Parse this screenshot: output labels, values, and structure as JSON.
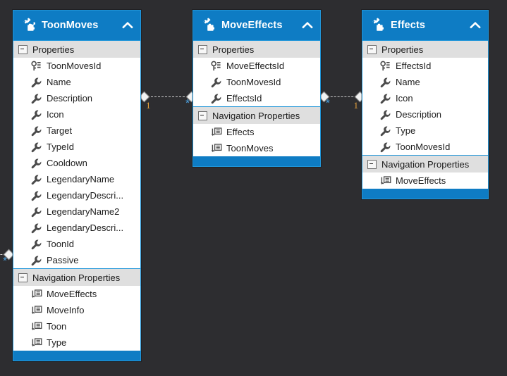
{
  "canvas": {
    "background": "#2d2d30",
    "accent": "#0e7cc4",
    "border": "#2196d9",
    "section_background": "#dfdfdf"
  },
  "entities": [
    {
      "name": "ToonMoves",
      "icon": "entity-icon",
      "collapse_icon": "chevron-up-icon",
      "sections": [
        {
          "label": "Properties",
          "expander_icon": "collapse-box-icon",
          "items": [
            {
              "label": "ToonMovesId",
              "icon": "key-icon"
            },
            {
              "label": "Name",
              "icon": "scalar-property-icon"
            },
            {
              "label": "Description",
              "icon": "scalar-property-icon"
            },
            {
              "label": "Icon",
              "icon": "scalar-property-icon"
            },
            {
              "label": "Target",
              "icon": "scalar-property-icon"
            },
            {
              "label": "TypeId",
              "icon": "scalar-property-icon"
            },
            {
              "label": "Cooldown",
              "icon": "scalar-property-icon"
            },
            {
              "label": "LegendaryName",
              "icon": "scalar-property-icon"
            },
            {
              "label": "LegendaryDescri...",
              "icon": "scalar-property-icon"
            },
            {
              "label": "LegendaryName2",
              "icon": "scalar-property-icon"
            },
            {
              "label": "LegendaryDescri...",
              "icon": "scalar-property-icon"
            },
            {
              "label": "ToonId",
              "icon": "scalar-property-icon"
            },
            {
              "label": "Passive",
              "icon": "scalar-property-icon"
            }
          ]
        },
        {
          "label": "Navigation Properties",
          "expander_icon": "collapse-box-icon",
          "items": [
            {
              "label": "MoveEffects",
              "icon": "navigation-property-icon"
            },
            {
              "label": "MoveInfo",
              "icon": "navigation-property-icon"
            },
            {
              "label": "Toon",
              "icon": "navigation-property-icon"
            },
            {
              "label": "Type",
              "icon": "navigation-property-icon"
            }
          ]
        }
      ]
    },
    {
      "name": "MoveEffects",
      "icon": "entity-icon",
      "collapse_icon": "chevron-up-icon",
      "sections": [
        {
          "label": "Properties",
          "expander_icon": "collapse-box-icon",
          "items": [
            {
              "label": "MoveEffectsId",
              "icon": "key-icon"
            },
            {
              "label": "ToonMovesId",
              "icon": "scalar-property-icon"
            },
            {
              "label": "EffectsId",
              "icon": "scalar-property-icon"
            }
          ]
        },
        {
          "label": "Navigation Properties",
          "expander_icon": "collapse-box-icon",
          "items": [
            {
              "label": "Effects",
              "icon": "navigation-property-icon"
            },
            {
              "label": "ToonMoves",
              "icon": "navigation-property-icon"
            }
          ]
        }
      ]
    },
    {
      "name": "Effects",
      "icon": "entity-icon",
      "collapse_icon": "chevron-up-icon",
      "sections": [
        {
          "label": "Properties",
          "expander_icon": "collapse-box-icon",
          "items": [
            {
              "label": "EffectsId",
              "icon": "key-icon"
            },
            {
              "label": "Name",
              "icon": "scalar-property-icon"
            },
            {
              "label": "Icon",
              "icon": "scalar-property-icon"
            },
            {
              "label": "Description",
              "icon": "scalar-property-icon"
            },
            {
              "label": "Type",
              "icon": "scalar-property-icon"
            },
            {
              "label": "ToonMovesId",
              "icon": "scalar-property-icon"
            }
          ]
        },
        {
          "label": "Navigation Properties",
          "expander_icon": "collapse-box-icon",
          "items": [
            {
              "label": "MoveEffects",
              "icon": "navigation-property-icon"
            }
          ]
        }
      ]
    }
  ],
  "associations": [
    {
      "source_multiplicity": "1",
      "target_multiplicity": "*"
    },
    {
      "source_multiplicity": "*",
      "target_multiplicity": "1"
    },
    {
      "source_multiplicity": "*",
      "target_multiplicity": ""
    }
  ]
}
